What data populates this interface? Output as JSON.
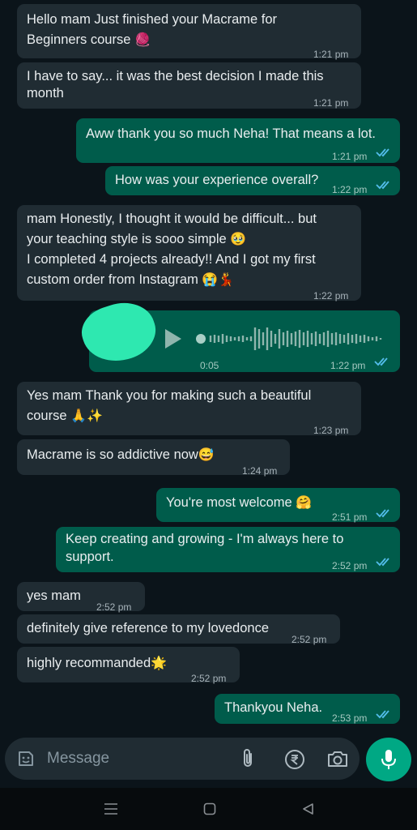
{
  "messages": [
    {
      "text": "Hello mam Just finished your Macrame for\nBeginners course",
      "emoji": "🧶",
      "time": "1:21 pm"
    },
    {
      "text": "I have to say... it was the best decision I made this\nmonth",
      "time": "1:21 pm"
    },
    {
      "text": "Aww thank you so much Neha! That means a lot.",
      "time": "1:21 pm"
    },
    {
      "text": "How was your experience overall?",
      "time": "1:22 pm"
    },
    {
      "text": "mam Honestly, I thought it would be difficult... but\nyour teaching style is sooo simple",
      "emoji": "🥹",
      "text2": "I completed 4 projects already!! And I got my first\ncustom order from Instagram",
      "emoji2": "😭💃",
      "time": "1:22 pm"
    },
    {
      "voice_duration": "0:05",
      "time": "1:22 pm"
    },
    {
      "text": "Yes mam Thank you for making such a beautiful\ncourse",
      "emoji": "🙏✨",
      "time": "1:23 pm"
    },
    {
      "text": "Macrame is so addictive now",
      "emoji": "😅",
      "time": "1:24 pm"
    },
    {
      "text": "You're most welcome",
      "emoji": "🤗",
      "time": "2:51 pm"
    },
    {
      "text": "Keep creating and growing - I'm always here to\nsupport.",
      "time": "2:52 pm"
    },
    {
      "text": "yes mam",
      "time": "2:52 pm"
    },
    {
      "text": "definitely give reference to my lovedonce",
      "time": "2:52 pm"
    },
    {
      "text": "highly recommanded",
      "emoji": "🌟",
      "time": "2:52 pm"
    },
    {
      "text": "Thankyou Neha.",
      "time": "2:53 pm"
    }
  ],
  "composer": {
    "placeholder": "Message"
  },
  "colors": {
    "background": "#0b141a",
    "incoming": "#202c33",
    "outgoing": "#005c4b",
    "accent": "#00a884",
    "read_ticks": "#53bdeb"
  },
  "icons": [
    "sticker-icon",
    "attach-icon",
    "rupee-icon",
    "camera-icon",
    "mic-icon",
    "play-icon",
    "nav-menu-icon",
    "nav-home-icon",
    "nav-back-icon"
  ]
}
